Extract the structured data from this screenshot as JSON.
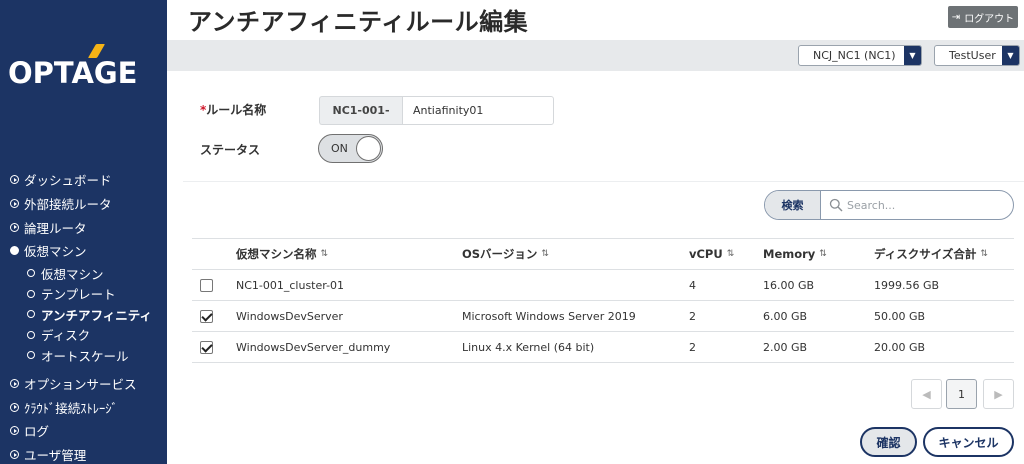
{
  "brand": {
    "logo_text": "OPTAGE",
    "accent_color": "#f5b316",
    "sidebar_color": "#1c3464"
  },
  "header": {
    "title": "アンチアフィニティルール編集",
    "logout_label": "ログアウト"
  },
  "topbar": {
    "tenant_select": "NCJ_NC1 (NC1)",
    "user_select": "TestUser"
  },
  "sidebar": {
    "items": [
      {
        "label": "ダッシュボード"
      },
      {
        "label": "外部接続ルータ"
      },
      {
        "label": "論理ルータ"
      },
      {
        "label": "仮想マシン",
        "open": true,
        "children": [
          {
            "label": "仮想マシン"
          },
          {
            "label": "テンプレート"
          },
          {
            "label": "アンチアフィニティ",
            "active": true
          },
          {
            "label": "ディスク"
          },
          {
            "label": "オートスケール"
          }
        ]
      },
      {
        "label": "オプションサービス"
      },
      {
        "label": "ｸﾗｳﾄﾞ接続ｽﾄﾚｰｼﾞ"
      },
      {
        "label": "ログ"
      },
      {
        "label": "ユーザ管理"
      }
    ]
  },
  "form": {
    "rule_name_label": "ルール名称",
    "required_mark": "*",
    "rule_prefix": "NC1-001-",
    "rule_name_value": "Antiafinity01",
    "status_label": "ステータス",
    "status_value": "ON"
  },
  "search": {
    "button_label": "検索",
    "placeholder": "Search..."
  },
  "table": {
    "headers": {
      "name": "仮想マシン名称",
      "os": "OSバージョン",
      "vcpu": "vCPU",
      "memory": "Memory",
      "disk": "ディスクサイズ合計"
    },
    "rows": [
      {
        "checked": false,
        "name": "NC1-001_cluster-01",
        "os": "",
        "vcpu": "4",
        "memory": "16.00 GB",
        "disk": "1999.56 GB"
      },
      {
        "checked": true,
        "name": "WindowsDevServer",
        "os": "Microsoft Windows Server 2019",
        "vcpu": "2",
        "memory": "6.00 GB",
        "disk": "50.00 GB"
      },
      {
        "checked": true,
        "name": "WindowsDevServer_dummy",
        "os": "Linux 4.x Kernel (64 bit)",
        "vcpu": "2",
        "memory": "2.00 GB",
        "disk": "20.00 GB"
      }
    ]
  },
  "pagination": {
    "prev": "◀",
    "current_page": "1",
    "next": "▶"
  },
  "actions": {
    "confirm_label": "確認",
    "cancel_label": "キャンセル"
  }
}
